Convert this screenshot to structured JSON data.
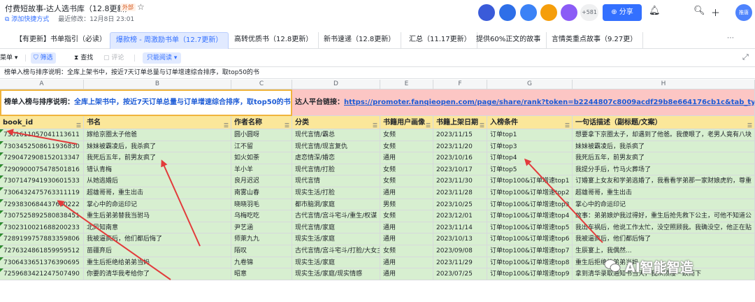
{
  "header": {
    "doc_title": "付费短故事-达人选书库（12.8更新）",
    "external_badge": "外部",
    "add_shortcut": "添加快捷方式",
    "last_modified": "最近修改：12月8日 23:01",
    "avatar_count": "+581",
    "share_label": "分享",
    "user_name": "推唐",
    "avatar_colors": [
      "#3a5bd9",
      "#2e6fe8",
      "#3b82f6",
      "#f59e0b",
      "#8b5cf6"
    ]
  },
  "tabs": [
    {
      "label": "【有更新】书单指引（必读）"
    },
    {
      "label": "爆款榜 - 周激励书单（12.7更新）"
    },
    {
      "label": "高转优质书（12.8更新）"
    },
    {
      "label": "新书速递（12.8更新）"
    },
    {
      "label": "汇总（11.17更新）"
    },
    {
      "label": "提供60%正文的故事"
    },
    {
      "label": "言情类重点故事（9.27更）"
    }
  ],
  "toolbar": {
    "menu": "菜单",
    "filter": "筛选",
    "search": "查找",
    "comment": "评论",
    "readonly": "只能阅读"
  },
  "formula_text": "榜单入榜与排序说明：全库上架书中，按近7天订单总量与订单增速综合排序，取top50的书",
  "columns": [
    "A",
    "B",
    "C",
    "D",
    "E",
    "F",
    "G",
    "H"
  ],
  "notice": {
    "left_label": "榜单入榜与排序说明：",
    "left_text": "全库上架书中，按近7天订单总量与订单增速综合排序，取top50的书",
    "right_label": "达人平台链接：",
    "right_link": "https://promoter.fanqieopen.com/page/share/rank?token=b2244807c8009acdf29b8e664176cb1c&tab_type=1&key="
  },
  "fields": [
    "book_id",
    "书名",
    "作者名称",
    "分类",
    "书籍用户画像",
    "书籍上架日期",
    "入榜条件",
    "一句话描述（副标题/文案）"
  ],
  "rows": [
    [
      "7301611057041113611",
      "嫁给京圈太子他爸",
      "圆小圆呀",
      "现代言情/霸总",
      "女频",
      "2023/11/15",
      "订单top1",
      "想要拿下京圈太子，却遇到了他爸。我傻眼了，老男人竟有八块"
    ],
    [
      "7303452508611936830",
      "妹妹被霸凌后，我杀疯了",
      "江不留",
      "现代言情/现言复仇",
      "女频",
      "2023/11/20",
      "订单top3",
      "妹妹被霸凌后，我杀疯了"
    ],
    [
      "7290472908152013347",
      "我死后五年，前男友疯了",
      "如火如荼",
      "虐恋情深/婚恋",
      "通用",
      "2023/10/16",
      "订单top4",
      "我死后五年，前男友疯了"
    ],
    [
      "7290900075478501816",
      "错认青梅",
      "羊小羊",
      "现代言情/打脸",
      "女频",
      "2023/10/17",
      "订单top5",
      "我提分手后，竹马火葬场了"
    ],
    [
      "7307147941930601533",
      "从她逃婚后",
      "良月迟迟",
      "现代言情",
      "女频",
      "2023/11/30",
      "订单top100&订单增速top1",
      "订婚宴上女友和学弟逃婚了，我看看学弟那一家财娘虎豹，尊重"
    ],
    [
      "7306432475763311119",
      "超雄哥哥，重生出击",
      "南雾山春",
      "现实生活/打脸",
      "通用",
      "2023/11/28",
      "订单top100&订单增速top2",
      "超雄哥哥，重生出击"
    ],
    [
      "7293830684437660222",
      "掌心中的命运印记",
      "晓晓羽毛",
      "都市脑洞/家庭",
      "男频",
      "2023/10/25",
      "订单top100&订单增速top3",
      "掌心中的命运印记"
    ],
    [
      "7307525892580838451",
      "重生后弟弟替我当驸马",
      "乌梅吃吃",
      "古代言情/宫斗宅斗/重生/权谋",
      "女频",
      "2023/12/01",
      "订单top100&订单增速top4",
      "故事：弟弟娘炉我过得好，重生后抢先救下公主，可他不知道公"
    ],
    [
      "7302310021688200233",
      "北风知南意",
      "尹艺涵",
      "现代言情/家庭",
      "通用",
      "2023/11/14",
      "订单top100&订单增速top5",
      "我出车祸后，他说工作太忙，没空照顾我。我确没空，他正在贴"
    ],
    [
      "7289199757883359806",
      "我被逼疯后，他们都后悔了",
      "师萊九九",
      "现实生活/家庭",
      "通用",
      "2023/10/13",
      "订单top100&订单增速top6",
      "我被逼疯后，他们都后悔了"
    ],
    [
      "7276324861859959512",
      "苗疆弃后",
      "陌叹",
      "古代言情/宫斗宅斗/打脸/大女主",
      "女频",
      "2023/09/08",
      "订单top100&订单增速top7",
      "生辰宴上，我偶然..."
    ],
    [
      "7306433651376390695",
      "重生后拒绝给弟弟当妈",
      "九卷锦",
      "现实生活/家庭",
      "通用",
      "2023/11/29",
      "订单top100&订单增速top8",
      "重生后拒绝给弟弟当妈"
    ],
    [
      "7259683421247507490",
      "你要的清华我考给你了",
      "昭意",
      "现实生活/家庭/现实情感",
      "通用",
      "2023/07/25",
      "订单top100&订单增速top9",
      "拿到清华录取通知书当天，我从顶楼一跃而下"
    ]
  ],
  "watermark": "AI智能智造"
}
